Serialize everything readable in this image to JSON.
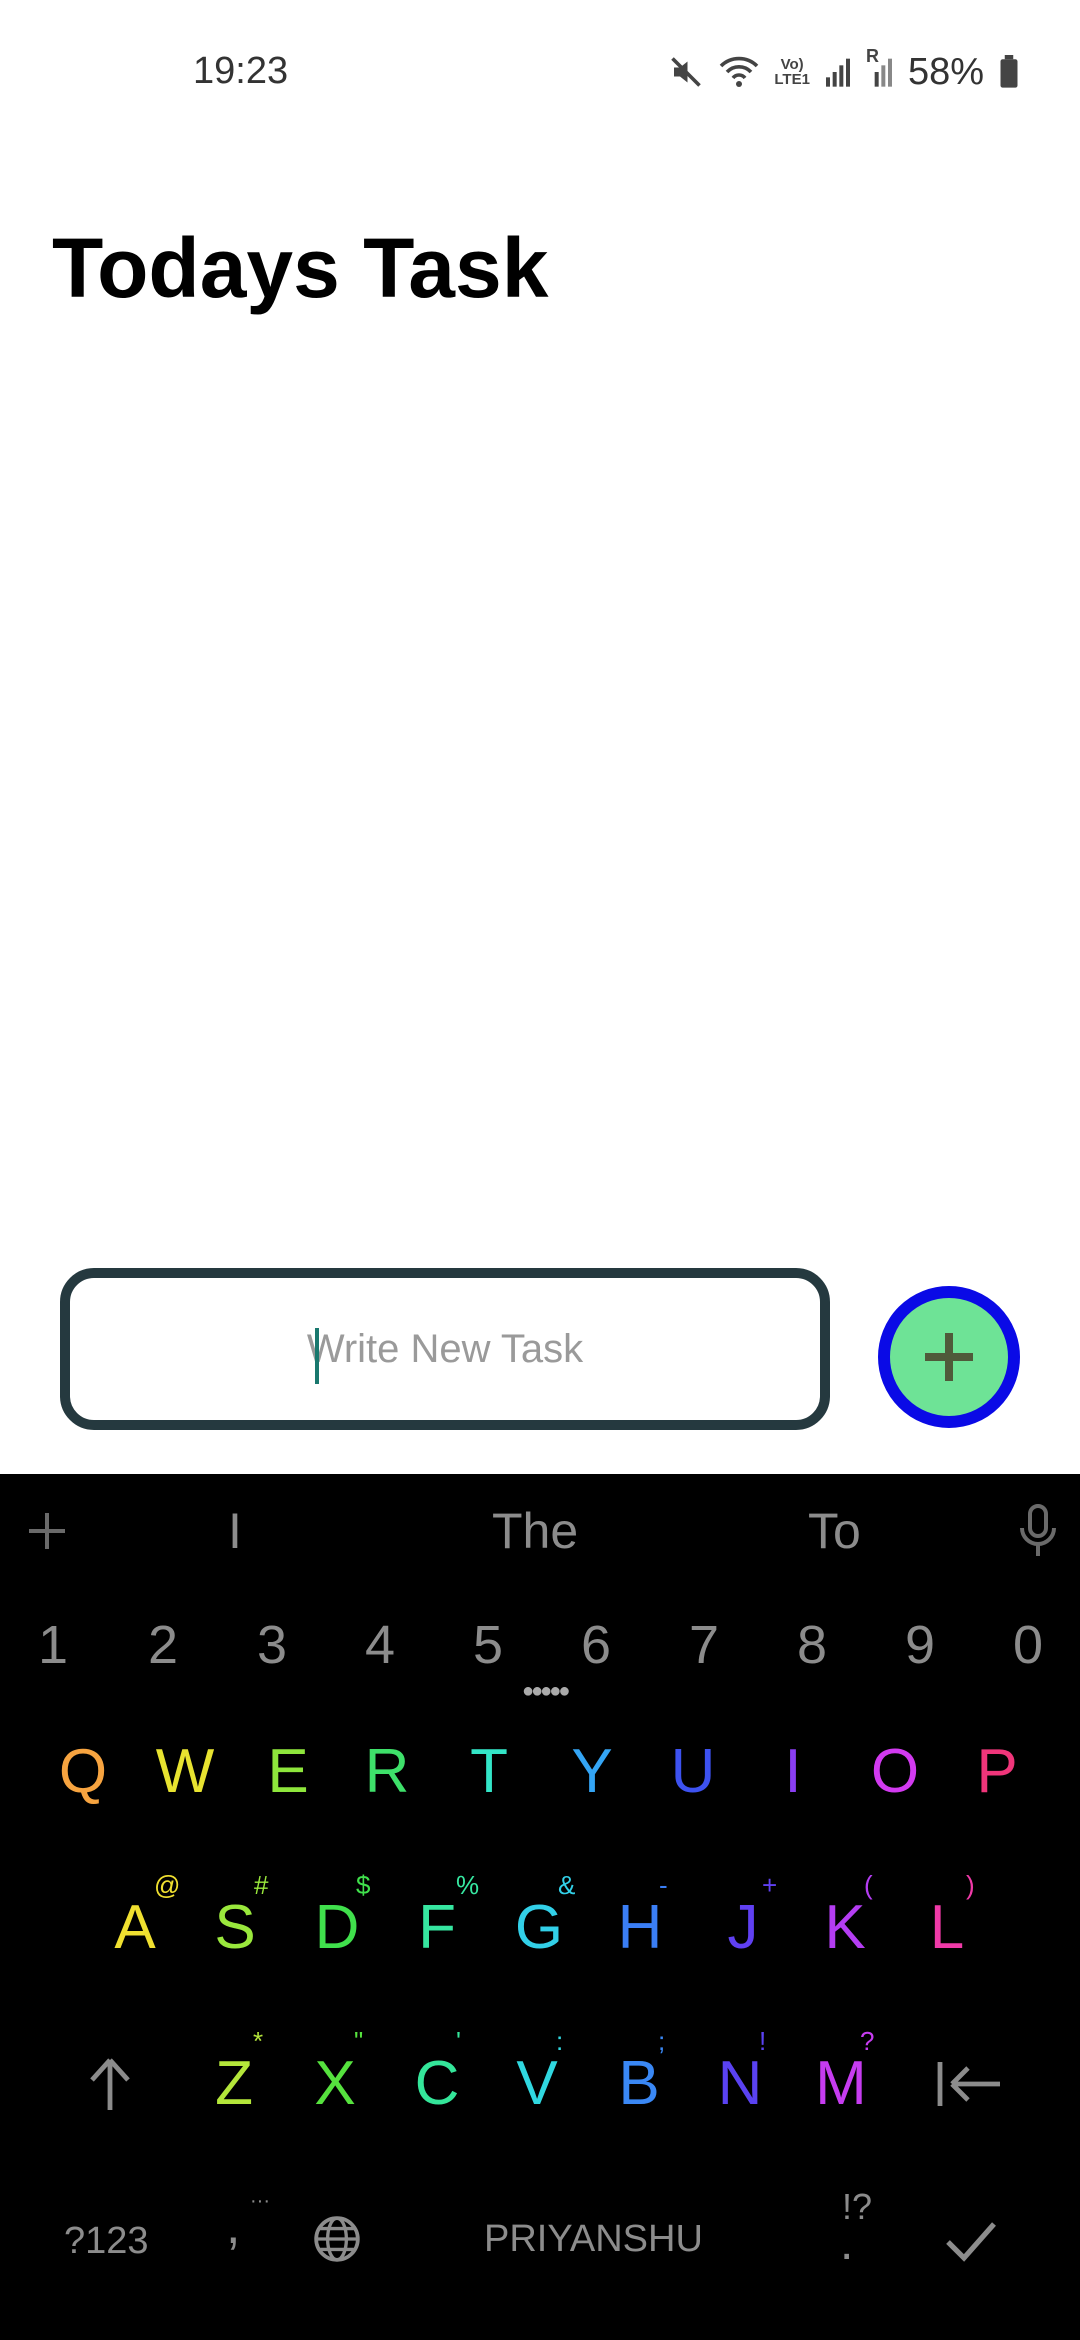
{
  "status": {
    "time": "19:23",
    "battery": "58%",
    "lte_top": "Vo)",
    "lte_bottom": "LTE1",
    "roaming": "R"
  },
  "title": "Todays Task",
  "task_input": {
    "placeholder": "Write New Task",
    "value": ""
  },
  "add_button": {
    "icon": "plus-icon",
    "color": "#6ee396",
    "border_color": "#0a0ae6"
  },
  "keyboard": {
    "suggestions": [
      "I",
      "The",
      "To"
    ],
    "numbers": [
      "1",
      "2",
      "3",
      "4",
      "5",
      "6",
      "7",
      "8",
      "9",
      "0"
    ],
    "row1": [
      {
        "k": "Q",
        "c": "#f7a440"
      },
      {
        "k": "W",
        "c": "#e8e330"
      },
      {
        "k": "E",
        "c": "#8ee63c"
      },
      {
        "k": "R",
        "c": "#3ee06a"
      },
      {
        "k": "T",
        "c": "#33e6c8"
      },
      {
        "k": "Y",
        "c": "#34a5f5"
      },
      {
        "k": "U",
        "c": "#3d52f0"
      },
      {
        "k": "I",
        "c": "#8a3ef2"
      },
      {
        "k": "O",
        "c": "#d23af0"
      },
      {
        "k": "P",
        "c": "#f0357a"
      }
    ],
    "row2": [
      {
        "k": "A",
        "s": "@",
        "c": "#f0e030"
      },
      {
        "k": "S",
        "s": "#",
        "c": "#9ae83c"
      },
      {
        "k": "D",
        "s": "$",
        "c": "#40e04c"
      },
      {
        "k": "F",
        "s": "%",
        "c": "#36e6a0"
      },
      {
        "k": "G",
        "s": "&",
        "c": "#32d0e8"
      },
      {
        "k": "H",
        "s": "-",
        "c": "#3a7ef5"
      },
      {
        "k": "J",
        "s": "+",
        "c": "#6040f2"
      },
      {
        "k": "K",
        "s": "(",
        "c": "#b43df2"
      },
      {
        "k": "L",
        "s": ")",
        "c": "#f03aa8"
      }
    ],
    "row3": [
      {
        "k": "Z",
        "s": "*",
        "c": "#b4e63a"
      },
      {
        "k": "X",
        "s": "\"",
        "c": "#56e23e"
      },
      {
        "k": "C",
        "s": "'",
        "c": "#34e69a"
      },
      {
        "k": "V",
        "s": ":",
        "c": "#30d8e0"
      },
      {
        "k": "B",
        "s": ";",
        "c": "#3a88f5"
      },
      {
        "k": "N",
        "s": "!",
        "c": "#5a42f2"
      },
      {
        "k": "M",
        "s": "?",
        "c": "#c63cf0"
      }
    ],
    "symbols_key": "?123",
    "comma_key": ",",
    "comma_sup": "···",
    "space_label": "PRIYANSHU",
    "period_key": ".",
    "period_sup": "!?"
  }
}
